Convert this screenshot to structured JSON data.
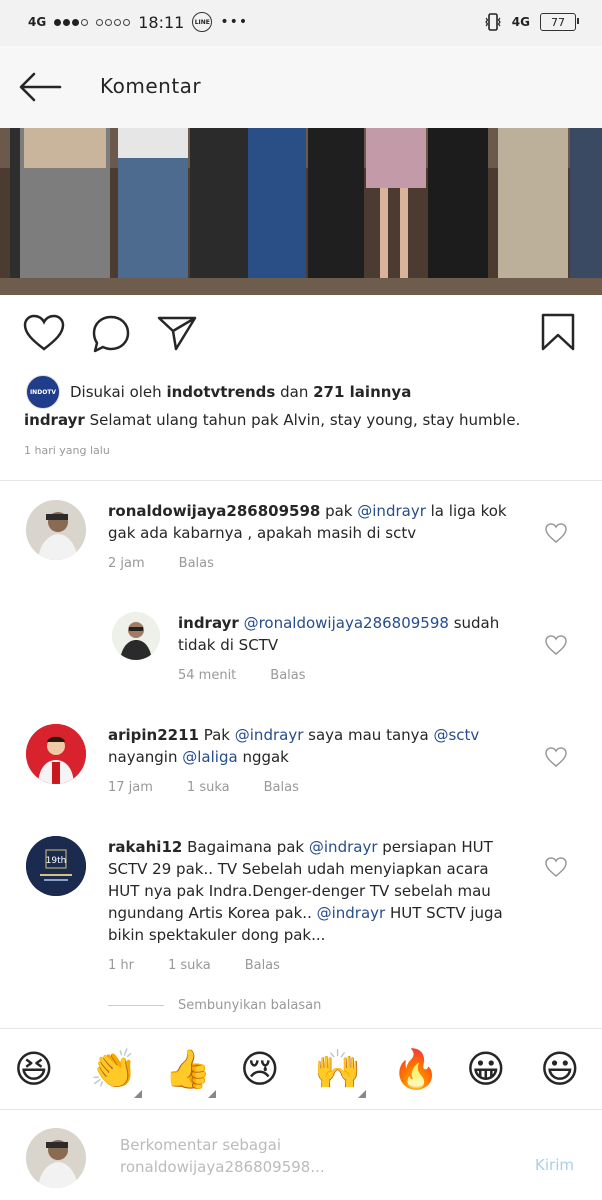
{
  "status_bar": {
    "network_left": "4G",
    "time": "18:11",
    "line_badge": "LINE",
    "more": "•••",
    "network_right": "4G",
    "battery": "77"
  },
  "header": {
    "title": "Komentar"
  },
  "post": {
    "likes": {
      "prefix": "Disukai oleh ",
      "user": "indotvtrends",
      "middle": " dan ",
      "count": "271 lainnya",
      "avatar_text": "INDOTV"
    },
    "caption": {
      "user": "indrayr",
      "text": " Selamat ulang tahun pak Alvin, stay young, stay humble."
    },
    "time_ago": "1 hari yang lalu"
  },
  "comments": [
    {
      "user": "ronaldowijaya286809598",
      "parts": [
        " pak ",
        "@indrayr",
        " la liga kok gak ada kabarnya , apakah masih di sctv"
      ],
      "time": "2 jam",
      "likes": "",
      "reply": "Balas"
    },
    {
      "user": "indrayr",
      "parts": [
        " ",
        "@ronaldowijaya286809598",
        " sudah tidak di SCTV"
      ],
      "time": "54 menit",
      "likes": "",
      "reply": "Balas"
    },
    {
      "user": "aripin2211",
      "parts": [
        " Pak ",
        "@indrayr",
        " saya mau tanya ",
        "@sctv",
        " nayangin ",
        "@laliga",
        " nggak"
      ],
      "time": "17 jam",
      "likes": "1 suka",
      "reply": "Balas"
    },
    {
      "user": "rakahi12",
      "parts": [
        " Bagaimana pak ",
        "@indrayr",
        " persiapan HUT SCTV 29 pak.. TV Sebelah udah menyiapkan acara HUT nya pak Indra.Denger-denger TV sebelah mau ngundang Artis Korea pak.. ",
        "@indrayr",
        " HUT SCTV juga bikin spektakuler dong pak..."
      ],
      "time": "1 hr",
      "likes": "1 suka",
      "reply": "Balas",
      "avatar_text": "19th"
    }
  ],
  "hide_replies": "Sembunyikan balasan",
  "emojis": [
    "😆",
    "👏",
    "👍",
    "😢",
    "🙌",
    "🔥",
    "😀",
    "😃"
  ],
  "composer": {
    "placeholder": "Berkomentar sebagai ronaldowijaya286809598...",
    "send": "Kirim"
  },
  "colors": {
    "mention": "#264d8c",
    "muted": "#999999",
    "send_disabled": "#a9cfe8"
  }
}
